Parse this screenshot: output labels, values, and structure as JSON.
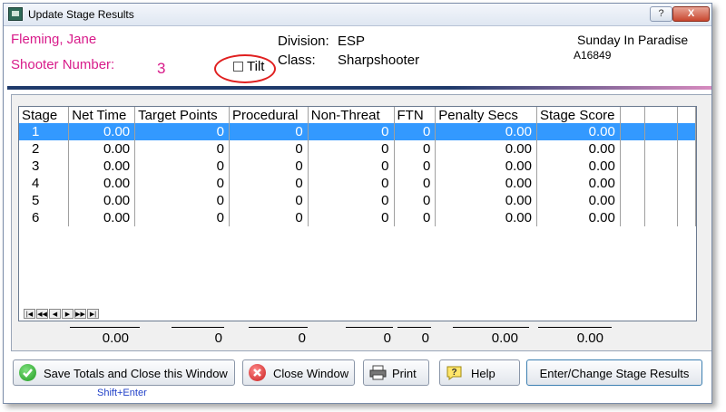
{
  "window": {
    "title": "Update Stage Results",
    "help_btn": "?",
    "close_btn": "X"
  },
  "shooter": {
    "name": "Fleming, Jane",
    "number_label": "Shooter Number:",
    "number": "3",
    "tilt_label": "Tilt",
    "tilt_checked": false,
    "division_label": "Division:",
    "division": "ESP",
    "class_label": "Class:",
    "class": "Sharpshooter",
    "match_name": "Sunday In Paradise",
    "id": "A16849"
  },
  "table": {
    "columns": [
      "Stage",
      "Net Time",
      "Target Points",
      "Procedural",
      "Non-Threat",
      "FTN",
      "Penalty Secs",
      "Stage Score"
    ],
    "rows": [
      [
        "1",
        "0.00",
        "0",
        "0",
        "0",
        "0",
        "0.00",
        "0.00"
      ],
      [
        "2",
        "0.00",
        "0",
        "0",
        "0",
        "0",
        "0.00",
        "0.00"
      ],
      [
        "3",
        "0.00",
        "0",
        "0",
        "0",
        "0",
        "0.00",
        "0.00"
      ],
      [
        "4",
        "0.00",
        "0",
        "0",
        "0",
        "0",
        "0.00",
        "0.00"
      ],
      [
        "5",
        "0.00",
        "0",
        "0",
        "0",
        "0",
        "0.00",
        "0.00"
      ],
      [
        "6",
        "0.00",
        "0",
        "0",
        "0",
        "0",
        "0.00",
        "0.00"
      ]
    ],
    "selected_row": 0
  },
  "navigator": [
    "|◀",
    "◀◀",
    "◀",
    "▶",
    "▶▶",
    "▶|"
  ],
  "totals": [
    "0.00",
    "0",
    "0",
    "0",
    "0",
    "0.00",
    "0.00"
  ],
  "buttons": {
    "save": "Save Totals and Close this Window",
    "save_hint": "Shift+Enter",
    "close": "Close Window",
    "print": "Print",
    "help": "Help",
    "enter": "Enter/Change Stage Results"
  },
  "colors": {
    "accent_pink": "#d81b8a",
    "selection": "#3399ff",
    "tilt_ring": "#e02020"
  }
}
